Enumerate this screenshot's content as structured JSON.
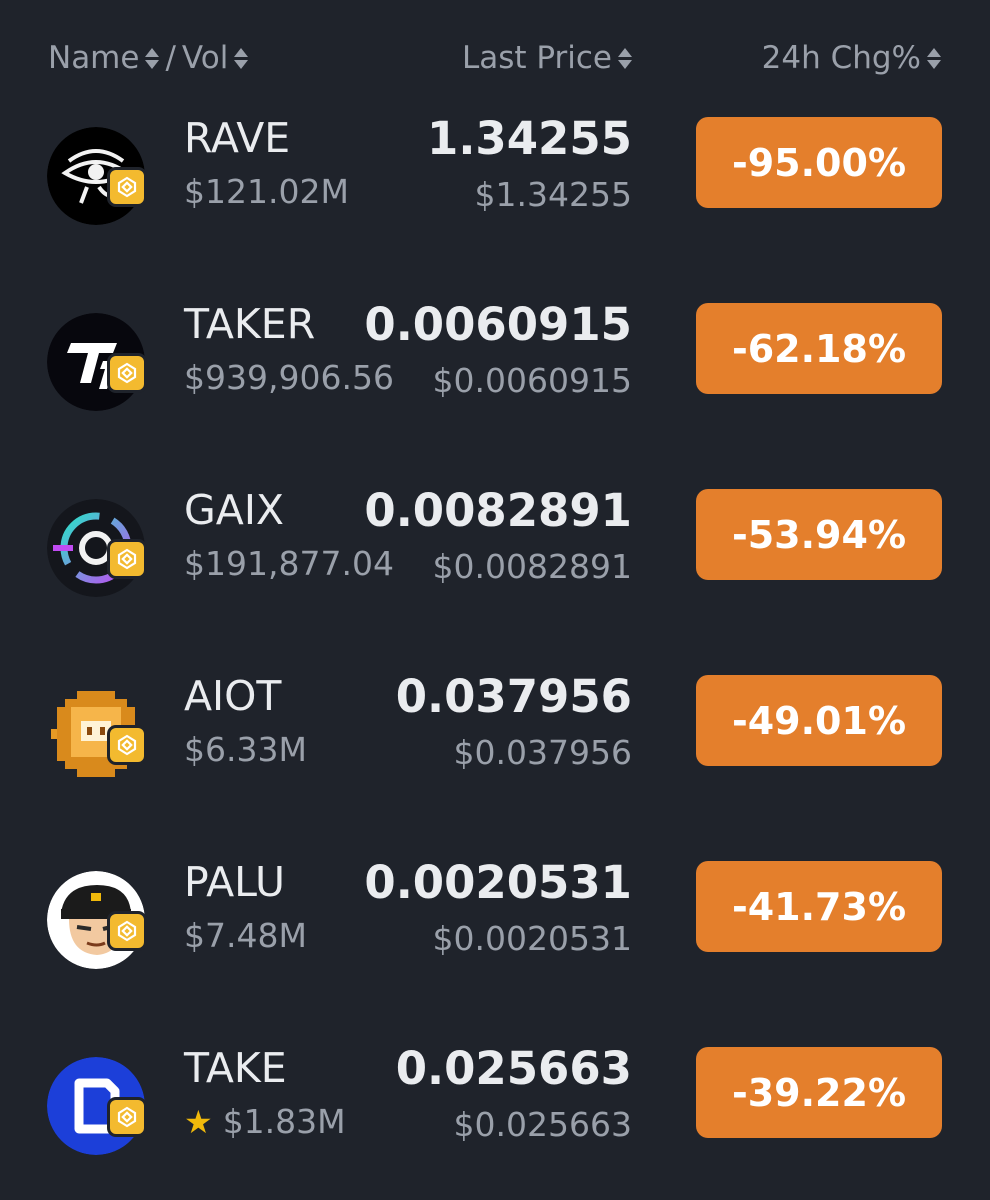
{
  "header": {
    "name_label": "Name",
    "separator": "/",
    "vol_label": "Vol",
    "price_label": "Last Price",
    "change_label": "24h Chg%"
  },
  "colors": {
    "background": "#1f232b",
    "negative_badge": "#e47f2c",
    "chain_badge": "#f3ba2f",
    "muted_text": "#9aa0aa",
    "primary_text": "#eaecef"
  },
  "rows": [
    {
      "symbol": "RAVE",
      "volume": "$121.02M",
      "price": "1.34255",
      "price_usd": "$1.34255",
      "change": "-95.00%",
      "icon": "rave-eye-logo",
      "starred": false
    },
    {
      "symbol": "TAKER",
      "volume": "$939,906.56",
      "price": "0.0060915",
      "price_usd": "$0.0060915",
      "change": "-62.18%",
      "icon": "taker-logo",
      "starred": false
    },
    {
      "symbol": "GAIX",
      "volume": "$191,877.04",
      "price": "0.0082891",
      "price_usd": "$0.0082891",
      "change": "-53.94%",
      "icon": "gaix-ring-logo",
      "starred": false
    },
    {
      "symbol": "AIOT",
      "volume": "$6.33M",
      "price": "0.037956",
      "price_usd": "$0.037956",
      "change": "-49.01%",
      "icon": "aiot-pixel-coin",
      "starred": false
    },
    {
      "symbol": "PALU",
      "volume": "$7.48M",
      "price": "0.0020531",
      "price_usd": "$0.0020531",
      "change": "-41.73%",
      "icon": "palu-character",
      "starred": false
    },
    {
      "symbol": "TAKE",
      "volume": "$1.83M",
      "price": "0.025663",
      "price_usd": "$0.025663",
      "change": "-39.22%",
      "icon": "take-logo",
      "starred": true
    }
  ]
}
